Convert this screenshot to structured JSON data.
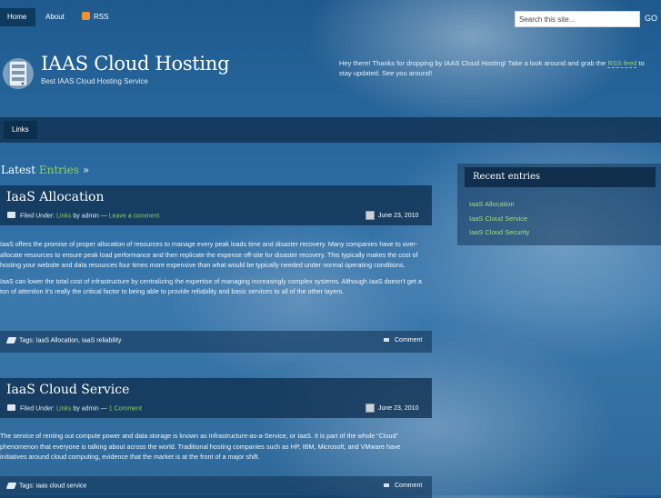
{
  "nav": {
    "home": "Home",
    "about": "About",
    "rss": "RSS"
  },
  "search": {
    "placeholder": "Search this site...",
    "value": "Search this site...",
    "go": "GO"
  },
  "site": {
    "title": "IAAS Cloud Hosting",
    "tagline": "Best IAAS Cloud Hosting Service"
  },
  "welcome": {
    "text_before": "Hey there! Thanks for dropping by IAAS Cloud Hosting! Take a look around and grab the ",
    "link": "RSS feed",
    "text_after": " to stay updated. See you around!"
  },
  "subnav": {
    "links": "Links"
  },
  "latest": {
    "prefix": "Latest",
    "accent": "Entries",
    "suffix": "»"
  },
  "posts": [
    {
      "title": "IaaS Allocation",
      "filed_under": "Filed Under:",
      "category": "Links",
      "by": "by admin —",
      "comment_link": "Leave a comment",
      "date": "June 23, 2010",
      "paragraphs": [
        "IaaS offers the promise of proper allocation of resources to manage every peak loads time and disaster recovery. Many companies have to over-allocate resources to ensure peak load performance and then replicate the expense off-site for disaster recovery. This typically makes the cost of hosting your website and data resources four times more expensive than what would be typically needed under normal operating conditions.",
        "IaaS can lower the total cost of infrastructure by centralizing the expertise of managing increasingly complex systems.  Although IaaS doesn’t get a ton of attention it’s  really the critical factor to being able to provide reliability and basic services to all of the other layers."
      ],
      "tags": "Tags: IaaS Allocation, IaaS reliability",
      "comment": "Comment"
    },
    {
      "title": "IaaS Cloud Service",
      "filed_under": "Filed Under:",
      "category": "Links",
      "by": "by admin —",
      "comment_link": "1 Comment",
      "date": "June 23, 2010",
      "paragraphs": [
        "The service of renting out compute power and data storage is known as Infrastructure-as-a-Service, or IaaS. It is part of the whole “Cloud” phenomenon that everyone is talking about across the world. Traditional hosting companies such as HP, IBM, Microsoft, and VMware have initiatives around cloud computing, evidence that the market is at the front of a major shift."
      ],
      "tags": "Tags: iaas cloud service",
      "comment": "Comment"
    }
  ],
  "sidebar": {
    "title": "Recent entries",
    "items": [
      "IaaS Allocation",
      "IaaS Cloud Service",
      "IaaS Cloud Security"
    ]
  },
  "icons": [
    "rss-icon",
    "server-logo-icon",
    "folder-icon",
    "calendar-icon",
    "tag-icon",
    "comment-icon"
  ],
  "colors": {
    "link_green": "#8fcf63",
    "nav_active": "#0d3a5e",
    "rss_orange": "#f0922e"
  }
}
